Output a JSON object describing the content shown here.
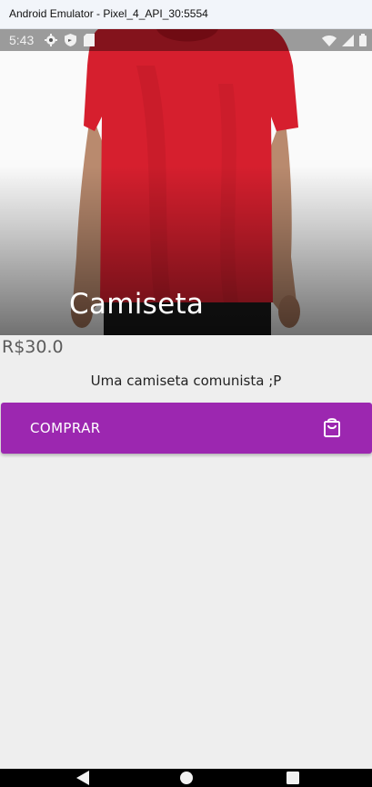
{
  "window": {
    "title": "Android Emulator - Pixel_4_API_30:5554"
  },
  "status_bar": {
    "time": "5:43",
    "left_icons": [
      "gear-icon",
      "shield-icon",
      "sd-card-icon"
    ],
    "right_icons": [
      "wifi-icon",
      "signal-icon",
      "battery-icon"
    ]
  },
  "product": {
    "title": "Camiseta",
    "price": "R$30.0",
    "description": "Uma camiseta comunista ;P",
    "image": "red-tshirt-photo"
  },
  "buy_button": {
    "label": "COMPRAR",
    "icon": "shopping-bag-icon"
  },
  "navigation": {
    "buttons": [
      "back-icon",
      "home-icon",
      "recents-icon"
    ]
  },
  "colors": {
    "accent": "#9c27b0",
    "background": "#eeeeee",
    "shirt": "#d61f2e",
    "titlebar": "#f2f5fa"
  }
}
